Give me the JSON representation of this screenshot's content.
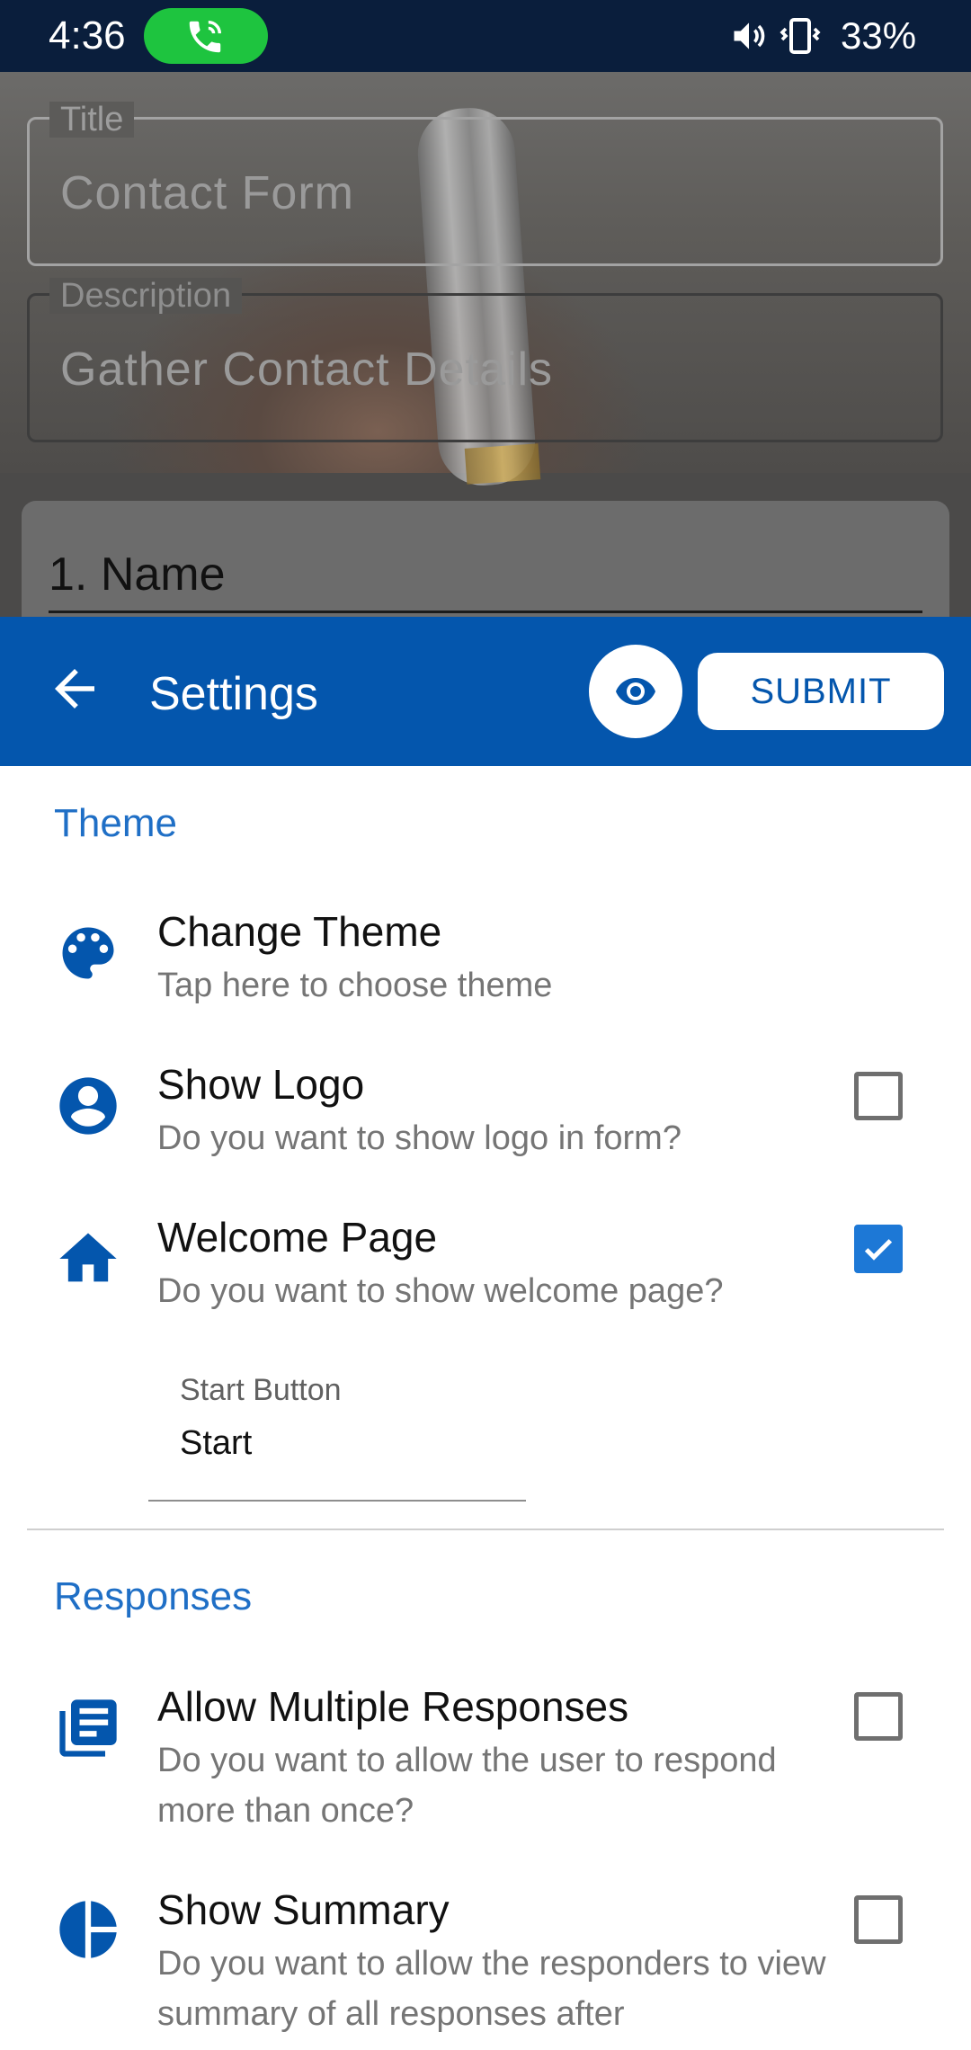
{
  "status_bar": {
    "time": "4:36",
    "call_icon": "phone-in-call-icon",
    "volume_icon": "volume-icon",
    "vibrate_icon": "vibrate-icon",
    "battery": "33%"
  },
  "background_form": {
    "title_label": "Title",
    "title_value": "Contact Form",
    "description_label": "Description",
    "description_value": "Gather Contact Details",
    "question_1": "1. Name"
  },
  "app_bar": {
    "back_icon": "arrow-back-icon",
    "title": "Settings",
    "preview_icon": "eye-icon",
    "submit_label": "SUBMIT",
    "color": "#0456ad"
  },
  "sections": {
    "theme": {
      "header": "Theme",
      "change_theme": {
        "icon": "palette-icon",
        "title": "Change Theme",
        "subtitle": "Tap here to choose theme"
      },
      "show_logo": {
        "icon": "account-circle-icon",
        "title": "Show Logo",
        "subtitle": "Do you want to show logo in form?",
        "checked": false
      },
      "welcome_page": {
        "icon": "home-icon",
        "title": "Welcome Page",
        "subtitle": "Do you want to show welcome page?",
        "checked": true
      },
      "start_button": {
        "label": "Start Button",
        "value": "Start"
      }
    },
    "responses": {
      "header": "Responses",
      "multiple_responses": {
        "icon": "library-books-icon",
        "title": "Allow Multiple Responses",
        "subtitle": "Do you want to allow the user to respond more than once?",
        "checked": false
      },
      "show_summary": {
        "icon": "pie-chart-icon",
        "title": "Show Summary",
        "subtitle": "Do you want to allow the responders to view summary of all responses after",
        "checked": false
      }
    }
  },
  "colors": {
    "accent": "#1f6fc6",
    "checkbox_checked": "#1d78d6",
    "status_bar": "#0a1e3c"
  }
}
